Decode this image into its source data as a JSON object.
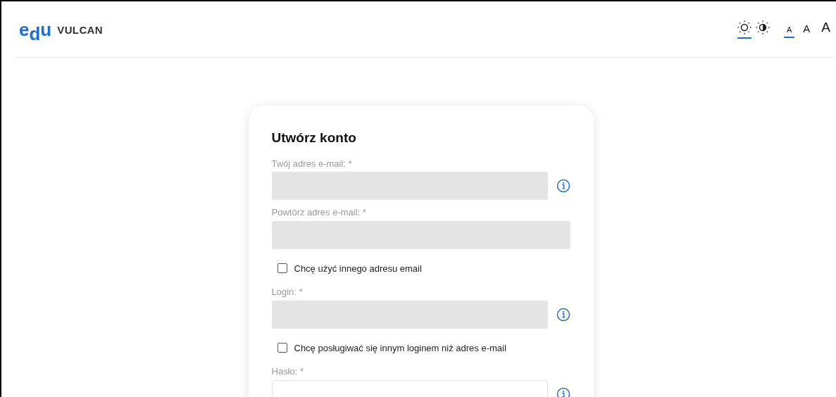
{
  "header": {
    "logo": {
      "mark": [
        "e",
        "d",
        "u"
      ],
      "name": "VULCAN"
    },
    "theme_options": [
      {
        "kind": "light",
        "selected": true
      },
      {
        "kind": "contrast",
        "selected": false
      }
    ],
    "font_sizes": [
      {
        "label": "A",
        "kind": "small",
        "selected": true
      },
      {
        "label": "A",
        "kind": "medium",
        "selected": false
      },
      {
        "label": "A",
        "kind": "large",
        "selected": false
      }
    ]
  },
  "form": {
    "title": "Utwórz konto",
    "rows": [
      {
        "kind": "field",
        "label": "Twój adres e-mail: *",
        "disabled": true,
        "info": true
      },
      {
        "kind": "field",
        "label": "Powtórz adres e-mail: *",
        "disabled": true,
        "info": false
      },
      {
        "kind": "checkbox",
        "label": "Chcę użyć innego adresu email",
        "checked": false
      },
      {
        "kind": "field",
        "label": "Login: *",
        "disabled": true,
        "info": true
      },
      {
        "kind": "checkbox",
        "label": "Chcę posługiwać się innym loginem niż adres e-mail",
        "checked": false
      },
      {
        "kind": "field",
        "label": "Hasło: *",
        "disabled": false,
        "info": true
      }
    ]
  }
}
